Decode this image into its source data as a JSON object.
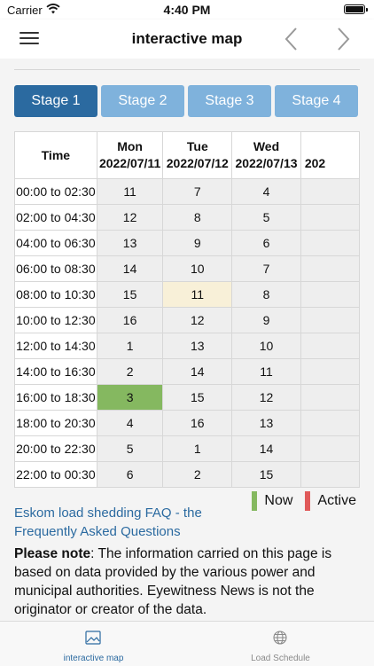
{
  "status_bar": {
    "carrier": "Carrier",
    "time": "4:40 PM"
  },
  "nav": {
    "title": "interactive map",
    "menu_icon": "hamburger-menu-icon",
    "back_icon": "chevron-left-icon",
    "forward_icon": "chevron-right-icon"
  },
  "stages": [
    {
      "label": "Stage 1",
      "selected": true
    },
    {
      "label": "Stage 2",
      "selected": false
    },
    {
      "label": "Stage 3",
      "selected": false
    },
    {
      "label": "Stage 4",
      "selected": false
    }
  ],
  "schedule": {
    "time_header": "Time",
    "days": [
      {
        "day": "Mon",
        "date": "2022/07/11"
      },
      {
        "day": "Tue",
        "date": "2022/07/12"
      },
      {
        "day": "Wed",
        "date": "2022/07/13"
      },
      {
        "day": "",
        "date": "202"
      }
    ],
    "rows": [
      {
        "time": "00:00 to 02:30",
        "values": [
          "11",
          "7",
          "4",
          ""
        ]
      },
      {
        "time": "02:00 to 04:30",
        "values": [
          "12",
          "8",
          "5",
          ""
        ]
      },
      {
        "time": "04:00 to 06:30",
        "values": [
          "13",
          "9",
          "6",
          ""
        ]
      },
      {
        "time": "06:00 to 08:30",
        "values": [
          "14",
          "10",
          "7",
          ""
        ]
      },
      {
        "time": "08:00 to 10:30",
        "values": [
          "15",
          "11",
          "8",
          ""
        ]
      },
      {
        "time": "10:00 to 12:30",
        "values": [
          "16",
          "12",
          "9",
          ""
        ]
      },
      {
        "time": "12:00 to 14:30",
        "values": [
          "1",
          "13",
          "10",
          ""
        ]
      },
      {
        "time": "14:00 to 16:30",
        "values": [
          "2",
          "14",
          "11",
          ""
        ]
      },
      {
        "time": "16:00 to 18:30",
        "values": [
          "3",
          "15",
          "12",
          ""
        ]
      },
      {
        "time": "18:00 to 20:30",
        "values": [
          "4",
          "16",
          "13",
          ""
        ]
      },
      {
        "time": "20:00 to 22:30",
        "values": [
          "5",
          "1",
          "14",
          ""
        ]
      },
      {
        "time": "22:00 to 00:30",
        "values": [
          "6",
          "2",
          "15",
          ""
        ]
      }
    ],
    "now_cell": {
      "row": 8,
      "col": 0
    },
    "active_cell": {
      "row": 4,
      "col": 1
    }
  },
  "legend": {
    "now_label": "Now",
    "now_color": "#85b860",
    "active_label": "Active",
    "active_color": "#e05a5a"
  },
  "faq_link": "Eskom load shedding FAQ - the Frequently Asked Questions",
  "note": {
    "bold": "Please note",
    "text": ": The information carried on this page is based on data provided by the various power and municipal authorities. Eyewitness News is not the originator or creator of the data."
  },
  "tabs": [
    {
      "label": "interactive map",
      "icon": "image-icon",
      "selected": true
    },
    {
      "label": "Load Schedule",
      "icon": "globe-icon",
      "selected": false
    }
  ]
}
